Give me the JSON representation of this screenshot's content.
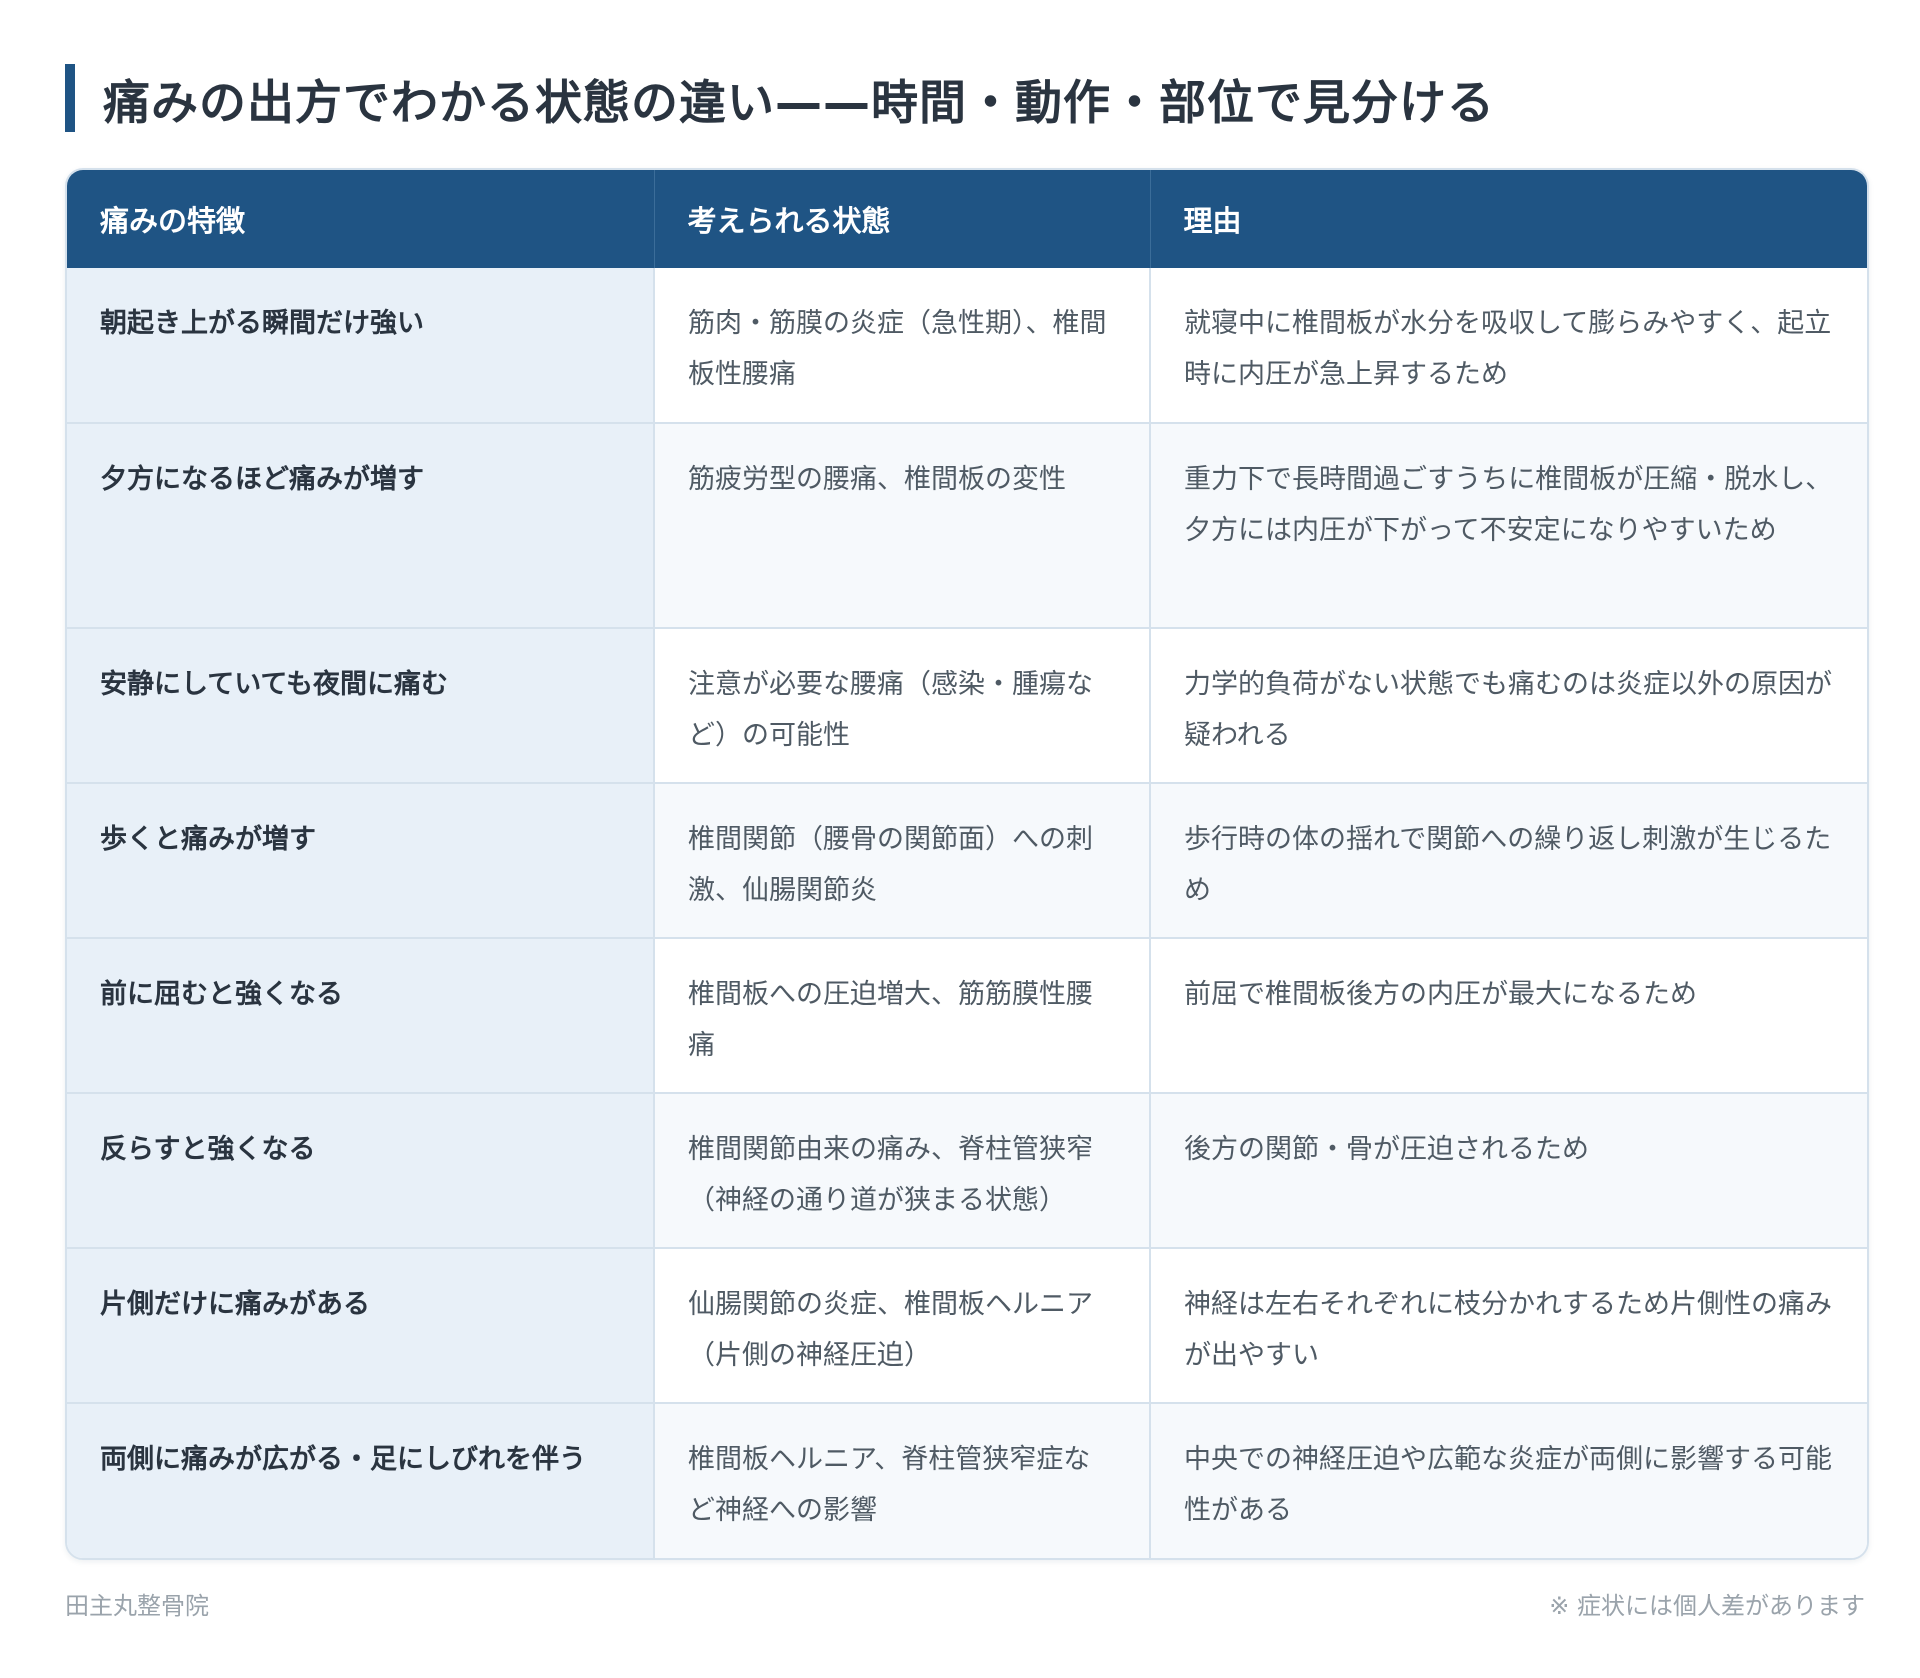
{
  "title": "痛みの出方でわかる状態の違い——時間・動作・部位で見分ける",
  "table": {
    "headers": [
      "痛みの特徴",
      "考えられる状態",
      "理由"
    ],
    "rows": [
      {
        "feature": "朝起き上がる瞬間だけ強い",
        "condition": "筋肉・筋膜の炎症（急性期）、椎間板性腰痛",
        "reason": "就寝中に椎間板が水分を吸収して膨らみやすく、起立時に内圧が急上昇するため"
      },
      {
        "feature": "夕方になるほど痛みが増す",
        "condition": "筋疲労型の腰痛、椎間板の変性",
        "reason": "重力下で長時間過ごすうちに椎間板が圧縮・脱水し、夕方には内圧が下がって不安定になりやすいため"
      },
      {
        "feature": "安静にしていても夜間に痛む",
        "condition": "注意が必要な腰痛（感染・腫瘍など）の可能性",
        "reason": "力学的負荷がない状態でも痛むのは炎症以外の原因が疑われる"
      },
      {
        "feature": "歩くと痛みが増す",
        "condition": "椎間関節（腰骨の関節面）への刺激、仙腸関節炎",
        "reason": "歩行時の体の揺れで関節への繰り返し刺激が生じるため"
      },
      {
        "feature": "前に屈むと強くなる",
        "condition": "椎間板への圧迫増大、筋筋膜性腰痛",
        "reason": "前屈で椎間板後方の内圧が最大になるため"
      },
      {
        "feature": "反らすと強くなる",
        "condition": "椎間関節由来の痛み、脊柱管狭窄（神経の通り道が狭まる状態）",
        "reason": "後方の関節・骨が圧迫されるため"
      },
      {
        "feature": "片側だけに痛みがある",
        "condition": "仙腸関節の炎症、椎間板ヘルニア（片側の神経圧迫）",
        "reason": "神経は左右それぞれに枝分かれするため片側性の痛みが出やすい"
      },
      {
        "feature": "両側に痛みが広がる・足にしびれを伴う",
        "condition": "椎間板ヘルニア、脊柱管狭窄症など神経への影響",
        "reason": "中央での神経圧迫や広範な炎症が両側に影響する可能性がある"
      }
    ]
  },
  "footer": {
    "clinic": "田主丸整骨院",
    "note": "※ 症状には個人差があります"
  },
  "colors": {
    "header_bg": "#1f5484",
    "feature_bg": "#e8f0f8",
    "border": "#d5e1ec"
  }
}
